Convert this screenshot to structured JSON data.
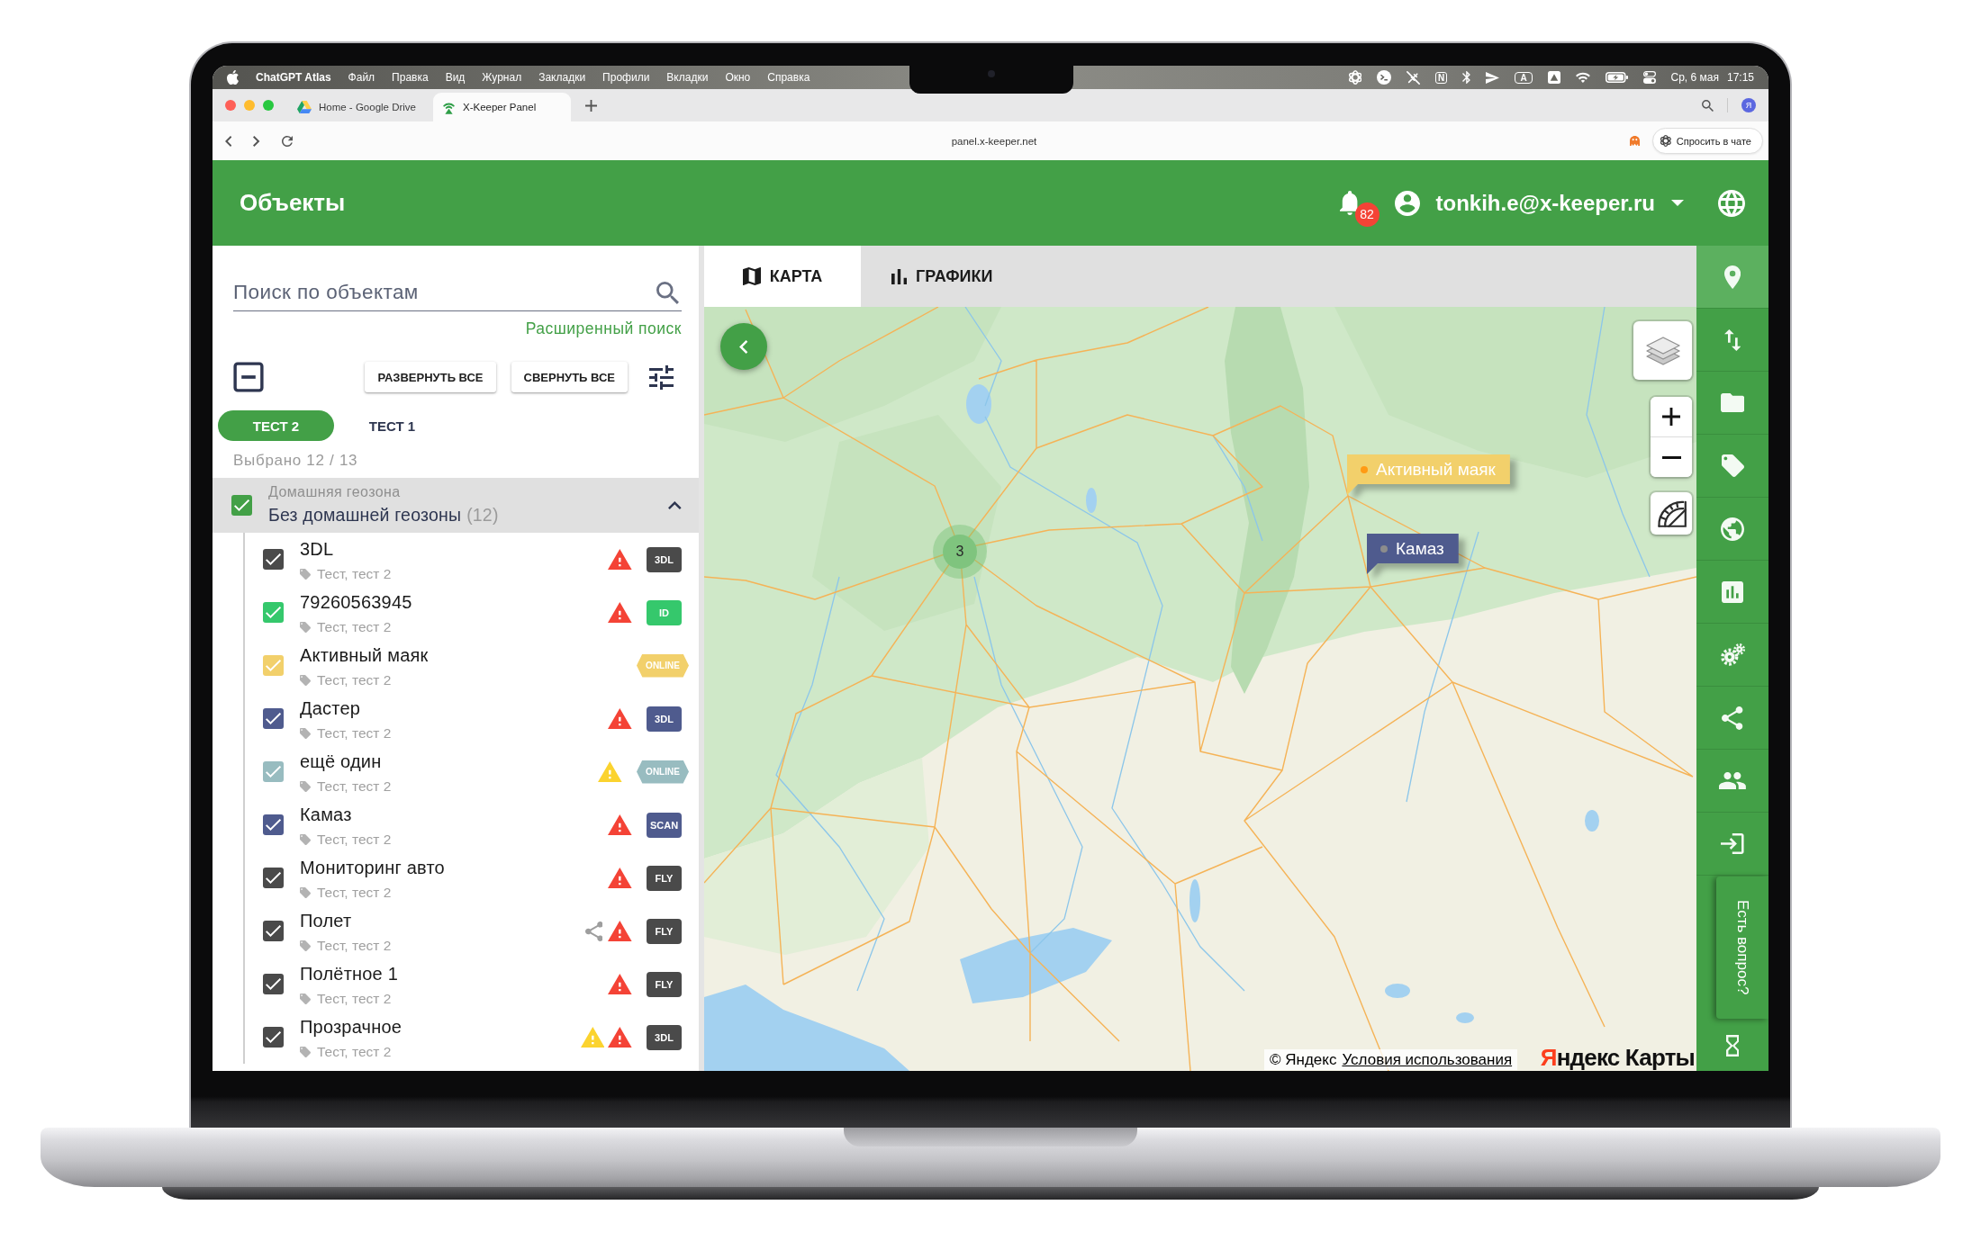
{
  "menu_bar": {
    "app": "ChatGPT Atlas",
    "menus": [
      "Файл",
      "Правка",
      "Вид",
      "Журнал",
      "Закладки",
      "Профили",
      "Вкладки",
      "Окно",
      "Справка"
    ],
    "app_badge": "N",
    "input_source": "A",
    "date": "Ср, 6 мая",
    "time": "17:15"
  },
  "browser": {
    "tabs": [
      {
        "title": "Home - Google Drive",
        "kind": "drive",
        "selected": false
      },
      {
        "title": "X-Keeper Panel",
        "kind": "xkeeper",
        "selected": true
      }
    ],
    "profile_initial": "Я",
    "address": "panel.x-keeper.net",
    "ask_button": "Спросить в чате"
  },
  "header": {
    "title": "Объекты",
    "notifications": "82",
    "user": "tonkih.e@x-keeper.ru"
  },
  "objects_panel": {
    "search": {
      "placeholder": "Поиск по объектам"
    },
    "advanced_search": "Расширенный поиск",
    "select_all": {
      "indeterminate": true
    },
    "expand_all": "РАЗВЕРНУТЬ ВСЕ",
    "collapse_all": "СВЕРНУТЬ ВСЕ",
    "filter_tabs": [
      {
        "label": "ТЕСТ 2",
        "selected": true
      },
      {
        "label": "ТЕСТ 1",
        "selected": false
      }
    ],
    "selection": "Выбрано 12 / 13",
    "group": {
      "caption": "Домашняя геозона",
      "name": "Без домашней геозоны",
      "count": "(12)",
      "checked": true,
      "expanded": true
    },
    "objects": [
      {
        "name": "3DL",
        "tags": "Тест, тест 2",
        "checked": true,
        "color": "#4a4a4a",
        "shared": false,
        "alerts": [
          {
            "kind": "alarm"
          }
        ],
        "badge": {
          "label": "3DL",
          "kind": "plate"
        }
      },
      {
        "name": "79260563945",
        "tags": "Тест, тест 2",
        "checked": true,
        "color": "#35c86c",
        "shared": false,
        "alerts": [
          {
            "kind": "alarm"
          }
        ],
        "badge": {
          "label": "ID",
          "kind": "plate"
        }
      },
      {
        "name": "Активный маяк",
        "tags": "Тест, тест 2",
        "checked": true,
        "color": "#f2d06b",
        "shared": false,
        "badge": {
          "label": "ONLINE",
          "kind": "hexagon"
        }
      },
      {
        "name": "Дастер",
        "tags": "Тест, тест 2",
        "checked": true,
        "color": "#4f5b8e",
        "shared": false,
        "alerts": [
          {
            "kind": "alarm"
          }
        ],
        "badge": {
          "label": "3DL",
          "kind": "plate"
        }
      },
      {
        "name": "ещё один",
        "tags": "Тест, тест 2",
        "checked": true,
        "color": "#98bcc0",
        "shared": false,
        "alerts": [
          {
            "kind": "warning"
          }
        ],
        "badge": {
          "label": "ONLINE",
          "kind": "hexagon"
        }
      },
      {
        "name": "Камаз",
        "tags": "Тест, тест 2",
        "checked": true,
        "color": "#4f5b8e",
        "shared": false,
        "alerts": [
          {
            "kind": "alarm"
          }
        ],
        "badge": {
          "label": "SCAN",
          "kind": "plate"
        }
      },
      {
        "name": "Мониторинг авто",
        "tags": "Тест, тест 2",
        "checked": true,
        "color": "#4a4a4a",
        "shared": false,
        "alerts": [
          {
            "kind": "alarm"
          }
        ],
        "badge": {
          "label": "FLY",
          "kind": "plate"
        }
      },
      {
        "name": "Полет",
        "tags": "Тест, тест 2",
        "checked": true,
        "color": "#4a4a4a",
        "shared": true,
        "alerts": [
          {
            "kind": "alarm"
          }
        ],
        "badge": {
          "label": "FLY",
          "kind": "plate"
        }
      },
      {
        "name": "Полётное 1",
        "tags": "Тест, тест 2",
        "checked": true,
        "color": "#4a4a4a",
        "shared": false,
        "alerts": [
          {
            "kind": "alarm"
          }
        ],
        "badge": {
          "label": "FLY",
          "kind": "plate"
        }
      },
      {
        "name": "Прозрачное",
        "tags": "Тест, тест 2",
        "checked": true,
        "color": "#4a4a4a",
        "shared": false,
        "alerts": [
          {
            "kind": "warning"
          },
          {
            "kind": "alarm"
          }
        ],
        "badge": {
          "label": "3DL",
          "kind": "plate"
        }
      }
    ]
  },
  "view_tabs": [
    {
      "label": "КАРТА",
      "kind": "map",
      "selected": true
    },
    {
      "label": "ГРАФИКИ",
      "kind": "charts",
      "selected": false
    }
  ],
  "map": {
    "markers": [
      {
        "label": "Активный маяк",
        "color": "#f2d06b",
        "online": true
      },
      {
        "label": "Камаз",
        "color": "#4f5b8e",
        "online": false
      }
    ],
    "cluster": "3",
    "copyright": "© Яндекс",
    "terms_link": "Условия использования",
    "logo": "Яндекс Карты"
  },
  "sidebar": {
    "items": [
      {
        "kind": "pin",
        "selected": true
      },
      {
        "kind": "arrows",
        "selected": false
      },
      {
        "kind": "folder",
        "selected": false
      },
      {
        "kind": "tag",
        "selected": false
      },
      {
        "kind": "globe",
        "selected": false
      },
      {
        "kind": "chart",
        "selected": false
      },
      {
        "kind": "gears",
        "selected": false
      },
      {
        "kind": "share",
        "selected": false
      },
      {
        "kind": "people",
        "selected": false
      },
      {
        "kind": "login",
        "selected": false
      },
      {
        "kind": "hourglass",
        "selected": false
      }
    ],
    "help_tab": "Есть вопрос?"
  }
}
